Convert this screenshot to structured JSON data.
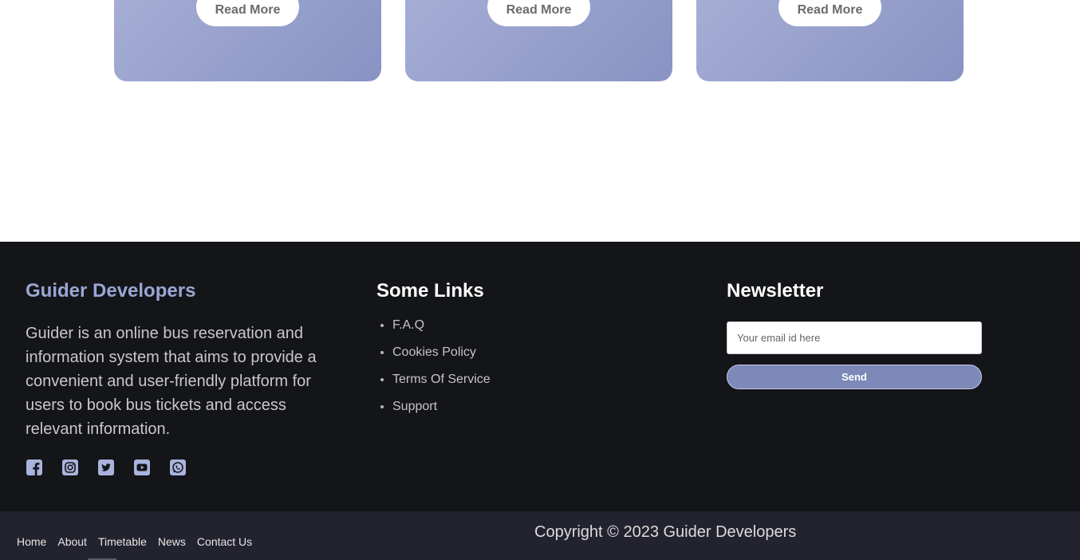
{
  "cards": [
    {
      "read_more_label": "Read More"
    },
    {
      "read_more_label": "Read More"
    },
    {
      "read_more_label": "Read More"
    }
  ],
  "footer": {
    "about": {
      "title": "Guider Developers",
      "text": "Guider is an online bus reservation and information system that aims to provide a convenient and user-friendly platform for users to book bus tickets and access relevant information.",
      "social_icons": [
        "facebook-icon",
        "instagram-icon",
        "twitter-icon",
        "youtube-icon",
        "whatsapp-icon"
      ]
    },
    "links": {
      "title": "Some Links",
      "items": [
        "F.A.Q",
        "Cookies Policy",
        "Terms Of Service",
        "Support"
      ]
    },
    "newsletter": {
      "title": "Newsletter",
      "email_placeholder": "Your email id here",
      "send_label": "Send"
    }
  },
  "bottom_bar": {
    "nav": [
      "Home",
      "About",
      "Timetable",
      "News",
      "Contact Us"
    ],
    "copyright": "Copyright © 2023 Guider Developers"
  },
  "colors": {
    "footer_bg": "#141518",
    "bottom_bar_bg": "#22232e",
    "accent": "#7c89b9",
    "brand_title": "#9aa6d4"
  }
}
